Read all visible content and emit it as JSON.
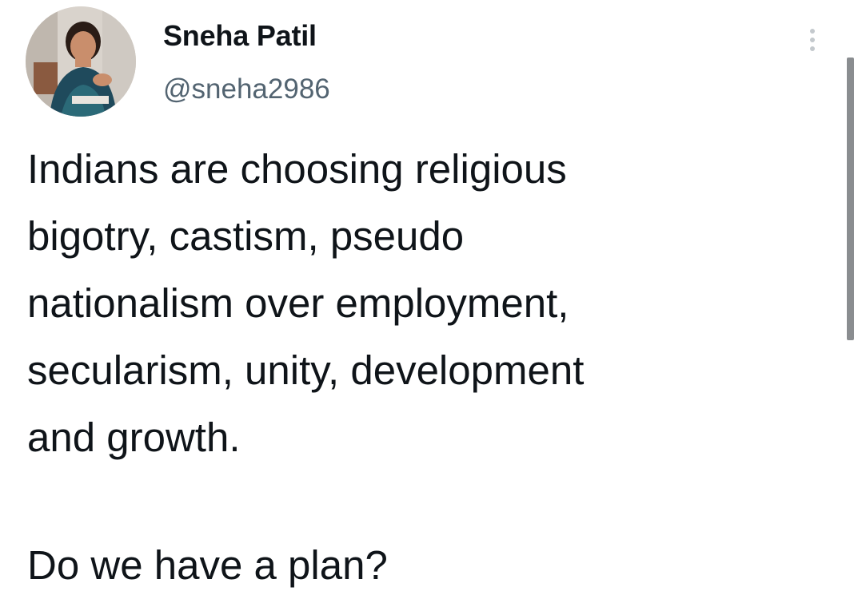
{
  "author": {
    "display_name": "Sneha Patil",
    "handle": "@sneha2986",
    "avatar_icon": "profile-photo"
  },
  "tweet": {
    "paragraph1_lines": [
      "Indians are choosing religious",
      "bigotry, castism, pseudo",
      "nationalism over employment,",
      "secularism, unity, development",
      "and growth."
    ],
    "paragraph2": "Do we have a plan?"
  },
  "controls": {
    "more_icon": "more-vertical-icon"
  },
  "colors": {
    "text_primary": "#0f1419",
    "text_secondary": "#536471",
    "background": "#ffffff"
  }
}
